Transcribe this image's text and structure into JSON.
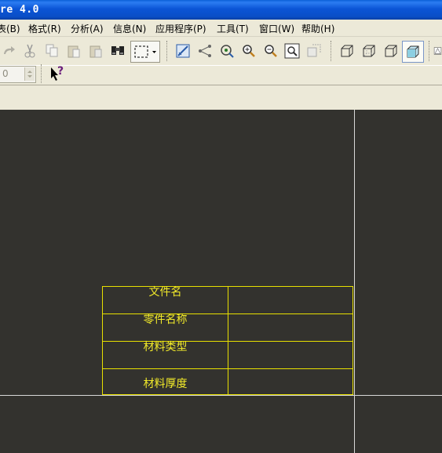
{
  "window": {
    "title": "re 4.0"
  },
  "menu": [
    "表(B)",
    "格式(R)",
    "分析(A)",
    "信息(N)",
    "应用程序(P)",
    "工具(T)",
    "窗口(W)",
    "帮助(H)"
  ],
  "toolbar2": {
    "spinner_value": "0",
    "help_glyph": "?"
  },
  "drawing_table": {
    "rows": [
      {
        "label": "文件名",
        "value": ""
      },
      {
        "label": "零件名称",
        "value": ""
      },
      {
        "label": "材料类型",
        "value": ""
      },
      {
        "label": "材料厚度",
        "value": ""
      }
    ]
  },
  "colors": {
    "canvas_bg": "#33322e",
    "table_line": "#e8e000",
    "table_text": "#f2ea2a",
    "title_bar": "#0b55d6"
  }
}
